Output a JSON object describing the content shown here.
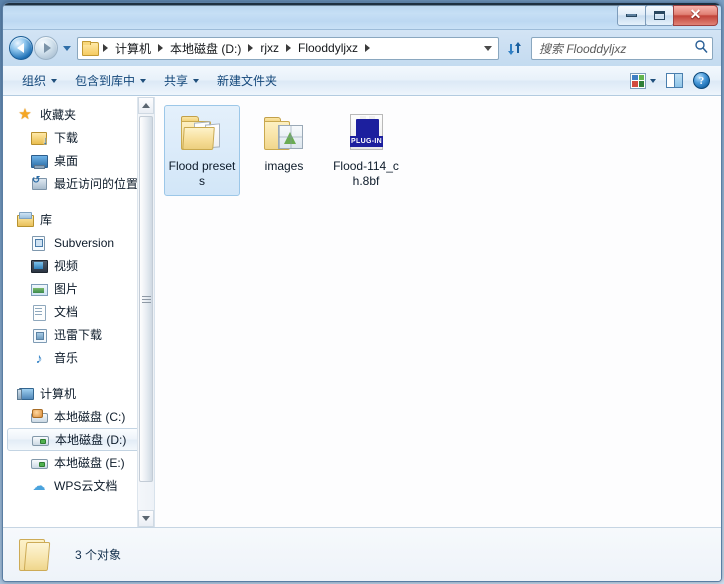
{
  "window": {
    "controls": {
      "minimize_label": "Minimize",
      "maximize_label": "Maximize",
      "close_label": "✕"
    }
  },
  "address": {
    "back_label": "后退",
    "forward_label": "前进",
    "recent_dropdown_label": "最近的位置",
    "breadcrumbs": [
      "计算机",
      "本地磁盘 (D:)",
      "rjxz",
      "Flooddyljxz"
    ],
    "refresh_label": "刷新"
  },
  "search": {
    "placeholder": "搜索 Flooddyljxz",
    "value": ""
  },
  "toolbar": {
    "organize_label": "组织",
    "include_library_label": "包含到库中",
    "share_label": "共享",
    "new_folder_label": "新建文件夹",
    "help_label": "?"
  },
  "sidebar": {
    "groups": [
      {
        "header": {
          "label": "收藏夹",
          "icon": "star-icon"
        },
        "items": [
          {
            "label": "下载",
            "icon": "downloads-icon"
          },
          {
            "label": "桌面",
            "icon": "desktop-icon"
          },
          {
            "label": "最近访问的位置",
            "icon": "recent-places-icon"
          }
        ]
      },
      {
        "header": {
          "label": "库",
          "icon": "library-icon"
        },
        "items": [
          {
            "label": "Subversion",
            "icon": "subversion-icon"
          },
          {
            "label": "视频",
            "icon": "videos-icon"
          },
          {
            "label": "图片",
            "icon": "pictures-icon"
          },
          {
            "label": "文档",
            "icon": "documents-icon"
          },
          {
            "label": "迅雷下载",
            "icon": "xunlei-icon"
          },
          {
            "label": "音乐",
            "icon": "music-icon"
          }
        ]
      },
      {
        "header": {
          "label": "计算机",
          "icon": "computer-icon"
        },
        "items": [
          {
            "label": "本地磁盘 (C:)",
            "icon": "system-drive-icon",
            "selected": false
          },
          {
            "label": "本地磁盘 (D:)",
            "icon": "drive-icon",
            "selected": true
          },
          {
            "label": "本地磁盘 (E:)",
            "icon": "drive-icon",
            "selected": false
          },
          {
            "label": "WPS云文档",
            "icon": "cloud-icon",
            "selected": false
          }
        ]
      }
    ]
  },
  "content": {
    "items": [
      {
        "name": "Flood presets",
        "type": "folder",
        "icon": "folder-with-documents-icon",
        "selected": true
      },
      {
        "name": "images",
        "type": "folder",
        "icon": "folder-with-picture-icon",
        "selected": false
      },
      {
        "name": "Flood-114_ch.8bf",
        "type": "file",
        "icon": "photoshop-plugin-icon",
        "badge": "PLUG-IN",
        "selected": false
      }
    ]
  },
  "status": {
    "item_count_text": "3 个对象",
    "icon": "folder-icon"
  },
  "colors": {
    "titlebar": "#c3dcf3",
    "accent": "#13477a",
    "selection": "#d2e6f8",
    "close_button": "#c2443a",
    "plugin_blue": "#1c1f9e",
    "folder_yellow": "#f7e1a0"
  }
}
